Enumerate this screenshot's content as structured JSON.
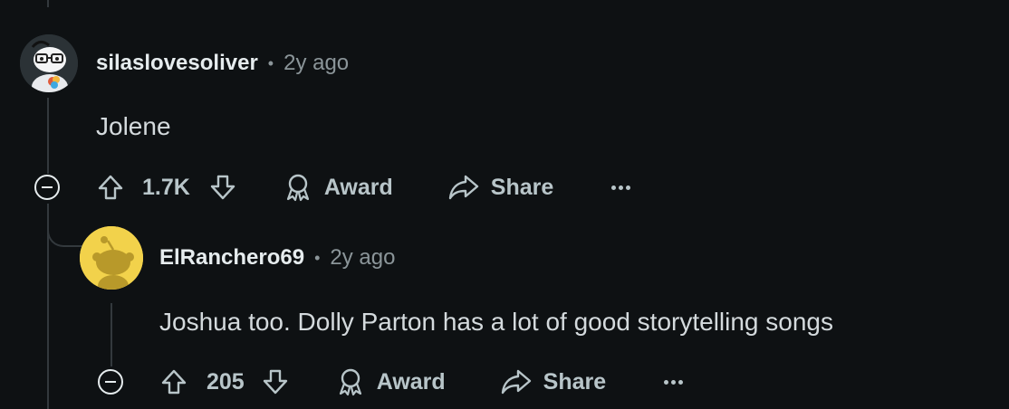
{
  "colors": {
    "background": "#0e1113",
    "text": "#d4dadd",
    "muted": "#8b9599",
    "thread_line": "#33393d",
    "snoo_yellow": "#f2d24b"
  },
  "comments": [
    {
      "username": "silaslovesoliver",
      "separator": "•",
      "time": "2y ago",
      "body": "Jolene",
      "votes": "1.7K",
      "award_label": "Award",
      "share_label": "Share",
      "more_label": "···"
    },
    {
      "username": "ElRanchero69",
      "separator": "•",
      "time": "2y ago",
      "body": "Joshua too. Dolly Parton has a lot of good storytelling songs",
      "votes": "205",
      "award_label": "Award",
      "share_label": "Share",
      "more_label": "···"
    }
  ]
}
